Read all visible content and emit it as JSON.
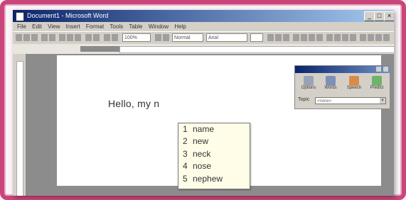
{
  "window": {
    "title": "Document1 - Microsoft Word"
  },
  "menu": [
    "File",
    "Edit",
    "View",
    "Insert",
    "Format",
    "Tools",
    "Table",
    "Window",
    "Help"
  ],
  "toolbar": {
    "zoom": "100%",
    "style": "Normal",
    "font": "Arial"
  },
  "document": {
    "text": "Hello, my n"
  },
  "suggestions": [
    {
      "num": "1",
      "word": "name"
    },
    {
      "num": "2",
      "word": "new"
    },
    {
      "num": "3",
      "word": "neck"
    },
    {
      "num": "4",
      "word": "nose"
    },
    {
      "num": "5",
      "word": "nephew"
    }
  ],
  "palette": {
    "buttons": [
      "Options",
      "Words",
      "Speech",
      "Predict"
    ],
    "topic_label": "Topic",
    "topic_value": "<none>"
  },
  "colors": {
    "frame": "#c9457a",
    "titlebar": "#0a246a",
    "suggest_bg": "#fffde8"
  }
}
